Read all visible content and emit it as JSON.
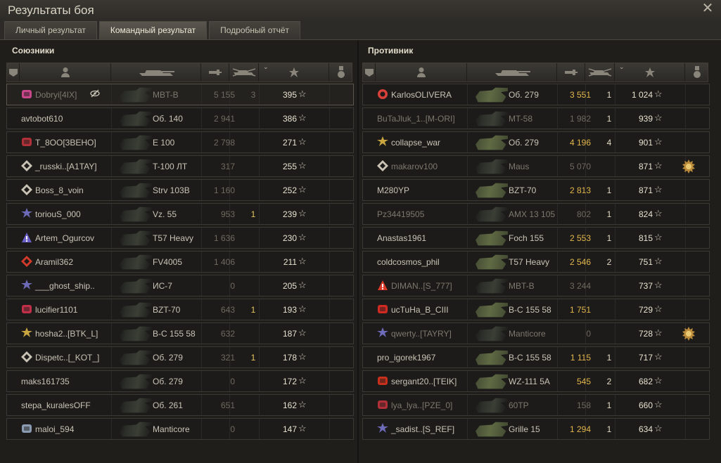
{
  "window": {
    "title": "Результаты боя",
    "close_icon": "close-icon"
  },
  "tabs": [
    {
      "label": "Личный результат",
      "active": false
    },
    {
      "label": "Командный результат",
      "active": true
    },
    {
      "label": "Подробный отчёт",
      "active": false
    }
  ],
  "columns": [
    "squad-icon",
    "player-icon",
    "tank-icon",
    "damage-icon",
    "kills-icon",
    "xp-star-icon",
    "medal-icon"
  ],
  "allies": {
    "title": "Союзники",
    "rows": [
      {
        "badge": "clan-badge-pink",
        "name": "Dobryi[4IX]",
        "extra_icon": "eye-crossed-icon",
        "vehicle": "MBT-B",
        "damage": "5 155",
        "kills": "3",
        "xp": "395",
        "dim": true,
        "highlight": true
      },
      {
        "badge": "",
        "name": "avtobot610",
        "vehicle": "Об. 140",
        "damage": "2 941",
        "kills": "",
        "xp": "386",
        "dim": false
      },
      {
        "badge": "clan-badge-nerv",
        "name": "T_8OO[3BEHO]",
        "vehicle": "E 100",
        "damage": "2 798",
        "kills": "",
        "xp": "271",
        "dim": false
      },
      {
        "badge": "clan-badge-diamond",
        "name": "_russki..[A1TAY]",
        "vehicle": "T-100 ЛТ",
        "damage": "317",
        "kills": "",
        "xp": "255",
        "dim": false
      },
      {
        "badge": "clan-badge-diamond",
        "name": "Boss_8_voin",
        "vehicle": "Strv 103B",
        "damage": "1 160",
        "kills": "",
        "xp": "252",
        "dim": false
      },
      {
        "badge": "clan-badge-star",
        "name": "toriouS_000",
        "vehicle": "Vz. 55",
        "damage": "953",
        "kills": "1",
        "xp": "239",
        "dim": false
      },
      {
        "badge": "clan-badge-triangle",
        "name": "Artem_Ogurcov",
        "vehicle": "T57 Heavy",
        "damage": "1 636",
        "kills": "",
        "xp": "230",
        "dim": false
      },
      {
        "badge": "clan-badge-diamond-red",
        "name": "Aramil362",
        "vehicle": "FV4005",
        "damage": "1 406",
        "kills": "",
        "xp": "211",
        "dim": false
      },
      {
        "badge": "clan-badge-star",
        "name": "___ghost_ship..",
        "vehicle": "ИС-7",
        "damage": "0",
        "kills": "",
        "xp": "205",
        "dim": false
      },
      {
        "badge": "clan-badge-lips",
        "name": "lucifier1101",
        "vehicle": "BZT-70",
        "damage": "643",
        "kills": "1",
        "xp": "193",
        "dim": false
      },
      {
        "badge": "clan-badge-gold",
        "name": "hosha2..[BTK_L]",
        "vehicle": "B-C 155 58",
        "damage": "632",
        "kills": "",
        "xp": "187",
        "dim": false
      },
      {
        "badge": "clan-badge-diamond",
        "name": "Dispetc..[_KOT_]",
        "vehicle": "Об. 279",
        "damage": "321",
        "kills": "1",
        "xp": "178",
        "dim": false
      },
      {
        "badge": "",
        "name": "maks161735",
        "vehicle": "Об. 279",
        "damage": "0",
        "kills": "",
        "xp": "172",
        "dim": false
      },
      {
        "badge": "",
        "name": "stepa_kuralesOFF",
        "vehicle": "Об. 261",
        "damage": "651",
        "kills": "",
        "xp": "162",
        "dim": false
      },
      {
        "badge": "clan-badge-wolf",
        "name": "maloi_594",
        "vehicle": "Manticore",
        "damage": "0",
        "kills": "",
        "xp": "147",
        "dim": false
      }
    ]
  },
  "enemies": {
    "title": "Противник",
    "rows": [
      {
        "badge": "clan-badge-red-ring",
        "name": "KarlosOLIVERA",
        "vehicle": "Об. 279",
        "damage": "3 551",
        "kills": "1",
        "xp": "1 024",
        "dim": false,
        "lit": true,
        "dmg_gold": true
      },
      {
        "badge": "",
        "name": "BuTaJluk_1..[M-ORI]",
        "vehicle": "MT-58",
        "damage": "1 982",
        "kills": "1",
        "xp": "939",
        "dim": true
      },
      {
        "badge": "clan-badge-gold",
        "name": "collapse_war",
        "vehicle": "Об. 279",
        "damage": "4 196",
        "kills": "4",
        "xp": "901",
        "dim": false,
        "lit": true,
        "dmg_gold": true
      },
      {
        "badge": "clan-badge-diamond",
        "name": "makarov100",
        "vehicle": "Maus",
        "damage": "5 070",
        "kills": "",
        "xp": "871",
        "dim": true,
        "medal": "medal-icon"
      },
      {
        "badge": "",
        "name": "M280YP",
        "vehicle": "BZT-70",
        "damage": "2 813",
        "kills": "1",
        "xp": "871",
        "dim": false,
        "lit": true,
        "dmg_gold": true
      },
      {
        "badge": "",
        "name": "Pz34419505",
        "vehicle": "AMX 13 105",
        "damage": "802",
        "kills": "1",
        "xp": "824",
        "dim": true
      },
      {
        "badge": "",
        "name": "Anastas1961",
        "vehicle": "Foch 155",
        "damage": "2 553",
        "kills": "1",
        "xp": "815",
        "dim": false,
        "lit": true,
        "dmg_gold": true
      },
      {
        "badge": "",
        "name": "coldcosmos_phil",
        "vehicle": "T57 Heavy",
        "damage": "2 546",
        "kills": "2",
        "xp": "751",
        "dim": false,
        "lit": true,
        "dmg_gold": true
      },
      {
        "badge": "clan-badge-warning",
        "name": "DIMAN..[S_777]",
        "vehicle": "MBT-B",
        "damage": "3 244",
        "kills": "",
        "xp": "737",
        "dim": true
      },
      {
        "badge": "clan-badge-sickle",
        "name": "ucTuHa_B_CIII",
        "vehicle": "B-C 155 58",
        "damage": "1 751",
        "kills": "",
        "xp": "729",
        "dim": false,
        "lit": true,
        "dmg_gold": true
      },
      {
        "badge": "clan-badge-star",
        "name": "qwerty..[TAYRY]",
        "vehicle": "Manticore",
        "damage": "0",
        "kills": "",
        "xp": "728",
        "dim": true,
        "medal": "medal-icon"
      },
      {
        "badge": "",
        "name": "pro_igorek1967",
        "vehicle": "B-C 155 58",
        "damage": "1 115",
        "kills": "1",
        "xp": "717",
        "dim": false,
        "lit": true,
        "dmg_gold": true
      },
      {
        "badge": "clan-badge-red",
        "name": "sergant20..[TEIK]",
        "vehicle": "WZ-111 5A",
        "damage": "545",
        "kills": "2",
        "xp": "682",
        "dim": false,
        "lit": true,
        "dmg_gold": true
      },
      {
        "badge": "clan-badge-nerv",
        "name": "lya_lya..[PZE_0]",
        "vehicle": "60TP",
        "damage": "158",
        "kills": "1",
        "xp": "660",
        "dim": true
      },
      {
        "badge": "clan-badge-star",
        "name": "_sadist..[S_REF]",
        "vehicle": "Grille 15",
        "damage": "1 294",
        "kills": "1",
        "xp": "634",
        "dim": false,
        "lit": true,
        "dmg_gold": true
      }
    ]
  }
}
